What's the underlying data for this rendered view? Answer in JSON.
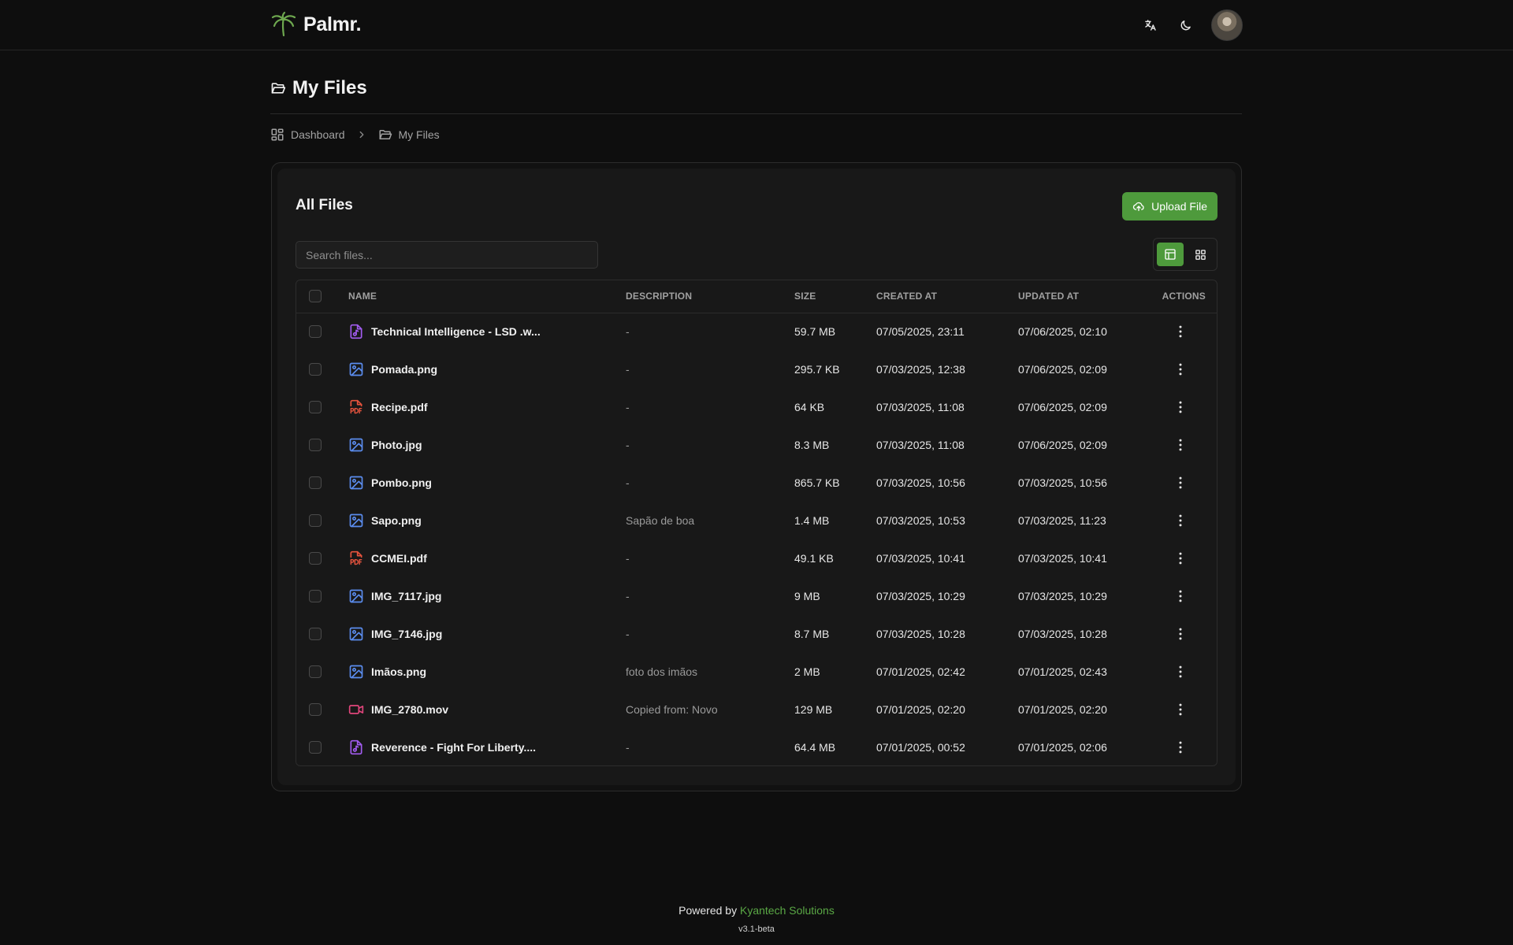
{
  "header": {
    "brand": "Palmr.",
    "icons": [
      "palm-logo-icon",
      "translate-icon",
      "moon-icon"
    ]
  },
  "page": {
    "title": "My Files"
  },
  "breadcrumb": {
    "dashboard": "Dashboard",
    "current": "My Files"
  },
  "card": {
    "title": "All Files",
    "upload_label": "Upload File",
    "search_placeholder": "Search files..."
  },
  "table": {
    "headers": {
      "name": "NAME",
      "description": "DESCRIPTION",
      "size": "SIZE",
      "created": "CREATED AT",
      "updated": "UPDATED AT",
      "actions": "ACTIONS"
    },
    "rows": [
      {
        "name": "Technical Intelligence - LSD .w...",
        "type": "audio",
        "description": "-",
        "size": "59.7 MB",
        "created": "07/05/2025, 23:11",
        "updated": "07/06/2025, 02:10"
      },
      {
        "name": "Pomada.png",
        "type": "image",
        "description": "-",
        "size": "295.7 KB",
        "created": "07/03/2025, 12:38",
        "updated": "07/06/2025, 02:09"
      },
      {
        "name": "Recipe.pdf",
        "type": "pdf",
        "description": "-",
        "size": "64 KB",
        "created": "07/03/2025, 11:08",
        "updated": "07/06/2025, 02:09"
      },
      {
        "name": "Photo.jpg",
        "type": "image",
        "description": "-",
        "size": "8.3 MB",
        "created": "07/03/2025, 11:08",
        "updated": "07/06/2025, 02:09"
      },
      {
        "name": "Pombo.png",
        "type": "image",
        "description": "-",
        "size": "865.7 KB",
        "created": "07/03/2025, 10:56",
        "updated": "07/03/2025, 10:56"
      },
      {
        "name": "Sapo.png",
        "type": "image",
        "description": "Sapão de boa",
        "size": "1.4 MB",
        "created": "07/03/2025, 10:53",
        "updated": "07/03/2025, 11:23"
      },
      {
        "name": "CCMEI.pdf",
        "type": "pdf",
        "description": "-",
        "size": "49.1 KB",
        "created": "07/03/2025, 10:41",
        "updated": "07/03/2025, 10:41"
      },
      {
        "name": "IMG_7117.jpg",
        "type": "image",
        "description": "-",
        "size": "9 MB",
        "created": "07/03/2025, 10:29",
        "updated": "07/03/2025, 10:29"
      },
      {
        "name": "IMG_7146.jpg",
        "type": "image",
        "description": "-",
        "size": "8.7 MB",
        "created": "07/03/2025, 10:28",
        "updated": "07/03/2025, 10:28"
      },
      {
        "name": "Imãos.png",
        "type": "image",
        "description": "foto dos imãos",
        "size": "2 MB",
        "created": "07/01/2025, 02:42",
        "updated": "07/01/2025, 02:43"
      },
      {
        "name": "IMG_2780.mov",
        "type": "video",
        "description": "Copied from: Novo",
        "size": "129 MB",
        "created": "07/01/2025, 02:20",
        "updated": "07/01/2025, 02:20"
      },
      {
        "name": "Reverence - Fight For Liberty....",
        "type": "audio",
        "description": "-",
        "size": "64.4 MB",
        "created": "07/01/2025, 00:52",
        "updated": "07/01/2025, 02:06"
      }
    ]
  },
  "footer": {
    "powered_by": "Powered by",
    "company": "Kyantech Solutions",
    "version": "v3.1-beta"
  },
  "colors": {
    "accent": "#4e9a3c",
    "audio_icon": "#a25cf0",
    "image_icon": "#5b8def",
    "pdf_icon": "#e5533d",
    "video_icon": "#e0457b"
  }
}
